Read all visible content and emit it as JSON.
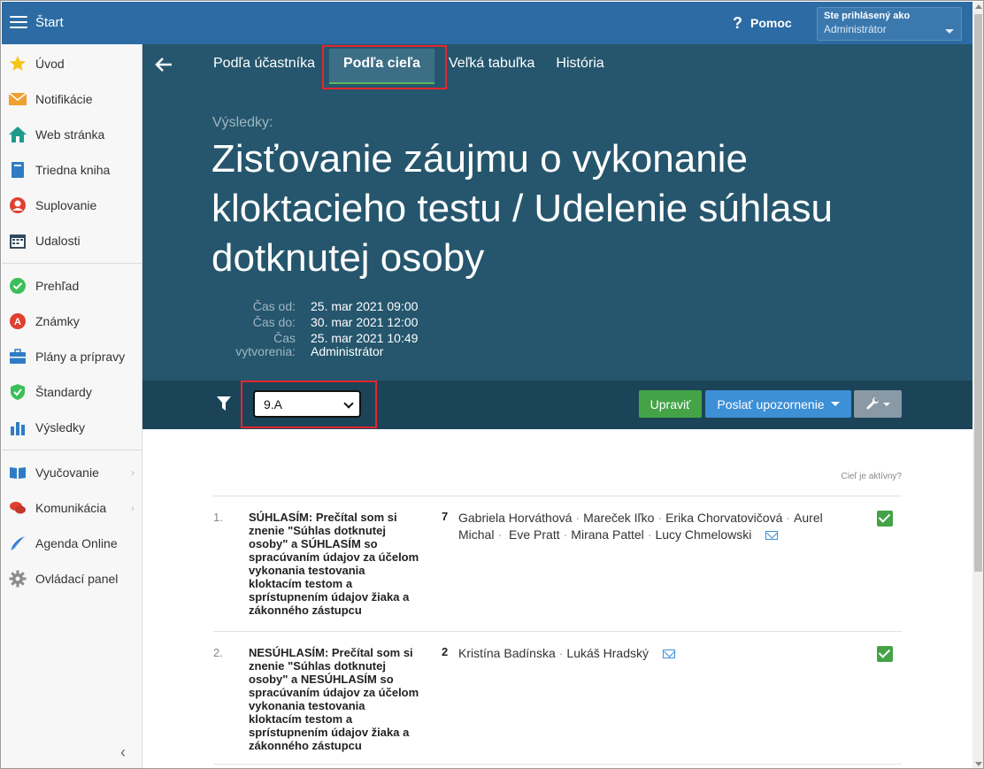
{
  "topbar": {
    "brand": "Štart",
    "help_label": "Pomoc",
    "user_line1": "Ste prihlásený ako",
    "user_line2": "Administrátor"
  },
  "sidebar": {
    "items": [
      {
        "label": "Úvod",
        "icon": "star-icon"
      },
      {
        "label": "Notifikácie",
        "icon": "envelope-icon"
      },
      {
        "label": "Web stránka",
        "icon": "home-icon"
      },
      {
        "label": "Triedna kniha",
        "icon": "book-icon"
      },
      {
        "label": "Suplovanie",
        "icon": "substitute-person-icon"
      },
      {
        "label": "Udalosti",
        "icon": "calendar-icon"
      },
      {
        "label": "Prehľad",
        "icon": "check-circle-icon"
      },
      {
        "label": "Známky",
        "icon": "grade-icon"
      },
      {
        "label": "Plány a prípravy",
        "icon": "briefcase-icon"
      },
      {
        "label": "Štandardy",
        "icon": "shield-icon"
      },
      {
        "label": "Výsledky",
        "icon": "bar-chart-icon"
      },
      {
        "label": "Vyučovanie",
        "icon": "open-book-icon"
      },
      {
        "label": "Komunikácia",
        "icon": "chat-icon"
      },
      {
        "label": "Agenda Online",
        "icon": "pen-icon"
      },
      {
        "label": "Ovládací panel",
        "icon": "gear-icon"
      }
    ]
  },
  "tabs": [
    "Podľa účastníka",
    "Podľa cieľa",
    "Veľká tabuľka",
    "História"
  ],
  "header": {
    "crumb": "Výsledky:",
    "title": "Zisťovanie záujmu o vykonanie kloktacieho testu / Udelenie súhlasu dotknutej osoby",
    "meta": {
      "from_label": "Čas od:",
      "from_value": "25. mar 2021 09:00",
      "to_label": "Čas do:",
      "to_value": "30. mar 2021 12:00",
      "created_label_1": "Čas",
      "created_label_2": "vytvorenia:",
      "created_value": "25. mar 2021 10:49",
      "created_by": "Administrátor"
    }
  },
  "toolbar": {
    "class_selected": "9.A",
    "edit_label": "Upraviť",
    "notify_label": "Poslať upozornenie"
  },
  "content": {
    "active_question": "Cieľ je aktívny?",
    "items": [
      {
        "num": "1.",
        "text": "SÚHLASÍM: Prečítal som si znenie \"Súhlas dotknutej osoby\" a SÚHLASÍM so spracúvaním údajov za účelom vykonania testovania kloktacím testom a sprístupnením údajov žiaka a zákonného zástupcu",
        "count": "7",
        "names": [
          "Gabriela Horváthová",
          "Mareček Iľko",
          "Erika Chorvatovičová",
          "Aurel Michal",
          "Eve Pratt",
          "Mirana Pattel",
          "Lucy Chmelowski"
        ]
      },
      {
        "num": "2.",
        "text": "NESÚHLASÍM: Prečítal som si znenie \"Súhlas dotknutej osoby\" a NESÚHLASÍM so spracúvaním údajov za účelom vykonania testovania kloktacím testom a sprístupnením údajov žiaka a zákonného zástupcu",
        "count": "2",
        "names": [
          "Kristína Badínska",
          "Lukáš Hradský"
        ]
      }
    ]
  },
  "colors": {
    "topbar": "#2c6ba3",
    "header": "#25566d",
    "toolbar": "#1c4458",
    "success": "#44a347",
    "primary": "#3d8fd6",
    "highlight": "#e5262d"
  }
}
